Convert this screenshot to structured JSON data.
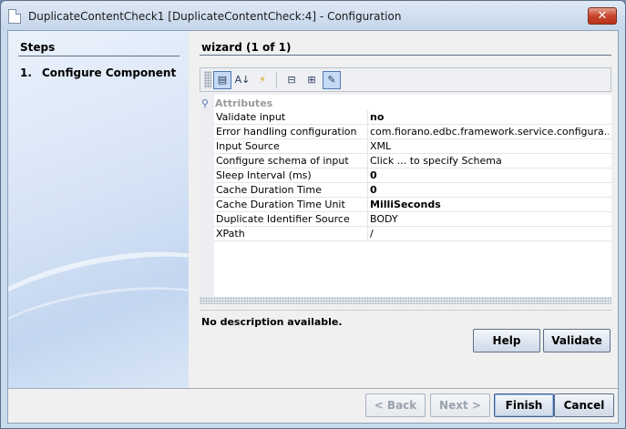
{
  "window": {
    "title": "DuplicateContentCheck1 [DuplicateContentCheck:4] - Configuration",
    "close_label": "✕"
  },
  "steps": {
    "title": "Steps",
    "items": [
      {
        "number": "1.",
        "label": "Configure Component"
      }
    ]
  },
  "wizard": {
    "title": "wizard (1 of 1)"
  },
  "toolbar": {
    "buttons": [
      {
        "icon": "categorized-view-icon",
        "glyph": "▤",
        "active": true
      },
      {
        "icon": "sort-alphabetical-icon",
        "glyph": "A↓"
      },
      {
        "icon": "flash-icon",
        "glyph": "⚡"
      },
      {
        "icon": "collapse-all-icon",
        "glyph": "⊟"
      },
      {
        "icon": "expand-all-icon",
        "glyph": "⊞"
      },
      {
        "icon": "edit-properties-icon",
        "glyph": "✎",
        "active": true
      }
    ]
  },
  "properties": {
    "category": "Attributes",
    "rows": [
      {
        "name": "Validate input",
        "value": "no",
        "bold": true
      },
      {
        "name": "Error handling configuration",
        "value": "com.fiorano.edbc.framework.service.configura...",
        "bold": false
      },
      {
        "name": "Input Source",
        "value": "XML",
        "bold": false
      },
      {
        "name": "Configure schema of input",
        "value": "Click ... to specify Schema",
        "bold": false
      },
      {
        "name": "Sleep Interval (ms)",
        "value": "0",
        "bold": true
      },
      {
        "name": "Cache Duration Time",
        "value": "0",
        "bold": true
      },
      {
        "name": "Cache Duration Time Unit",
        "value": "MilliSeconds",
        "bold": true
      },
      {
        "name": "Duplicate Identifier Source",
        "value": "BODY",
        "bold": false
      },
      {
        "name": "XPath",
        "value": "/",
        "bold": false
      }
    ]
  },
  "description": "No description available.",
  "actions": {
    "help": "Help",
    "validate": "Validate"
  },
  "footer": {
    "back": "< Back",
    "next": "Next >",
    "finish": "Finish",
    "cancel": "Cancel"
  }
}
